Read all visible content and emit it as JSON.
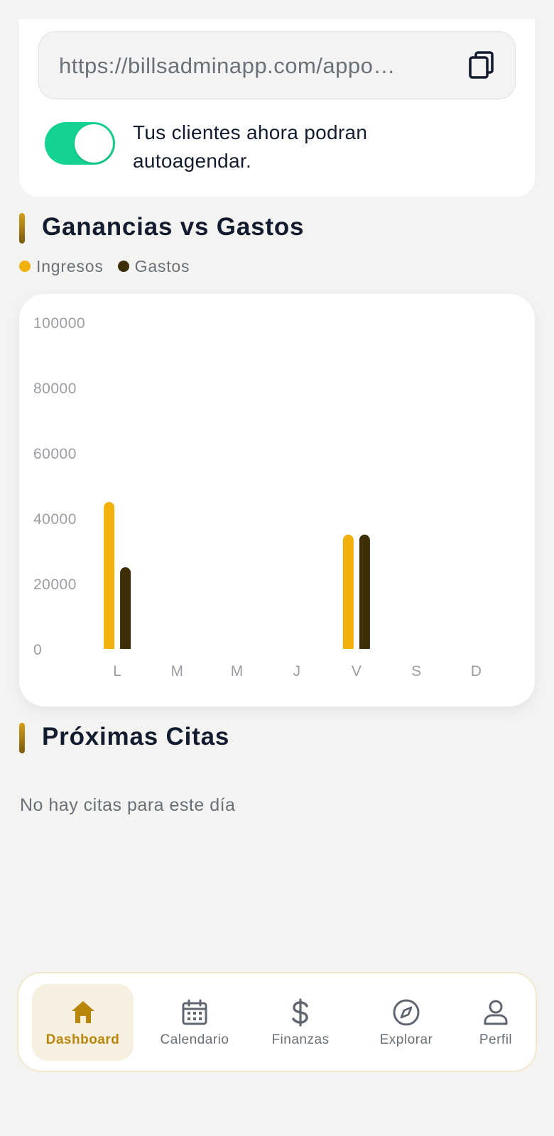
{
  "booking_link": {
    "url": "https://billsadminapp.com/appo…",
    "copy_icon": "copy-icon"
  },
  "self_booking": {
    "enabled": true,
    "label": "Tus clientes ahora podran autoagendar.",
    "accent_color": "#14d391"
  },
  "finance_section": {
    "title": "Ganancias vs Gastos",
    "legend": [
      {
        "label": "Ingresos",
        "color": "#f2b10d"
      },
      {
        "label": "Gastos",
        "color": "#3d2e06"
      }
    ]
  },
  "chart_data": {
    "type": "bar",
    "categories": [
      "L",
      "M",
      "M",
      "J",
      "V",
      "S",
      "D"
    ],
    "series": [
      {
        "name": "Ingresos",
        "color": "#f2b10d",
        "values": [
          45000,
          0,
          0,
          0,
          35000,
          0,
          0
        ]
      },
      {
        "name": "Gastos",
        "color": "#3d2e06",
        "values": [
          25000,
          0,
          0,
          0,
          35000,
          0,
          0
        ]
      }
    ],
    "y_ticks": [
      "100000",
      "80000",
      "60000",
      "40000",
      "20000",
      "0"
    ],
    "ylim": [
      0,
      100000
    ],
    "grid": false,
    "legend": "top-left"
  },
  "appointments_section": {
    "title": "Próximas Citas",
    "empty_message": "No hay citas para este día"
  },
  "bottom_nav": {
    "items": [
      {
        "label": "Dashboard",
        "icon": "home-icon",
        "active": true
      },
      {
        "label": "Calendario",
        "icon": "calendar-icon",
        "active": false
      },
      {
        "label": "Finanzas",
        "icon": "dollar-icon",
        "active": false
      },
      {
        "label": "Explorar",
        "icon": "compass-icon",
        "active": false
      },
      {
        "label": "Perfil",
        "icon": "user-icon",
        "active": false
      }
    ],
    "active_color": "#b8860b"
  }
}
